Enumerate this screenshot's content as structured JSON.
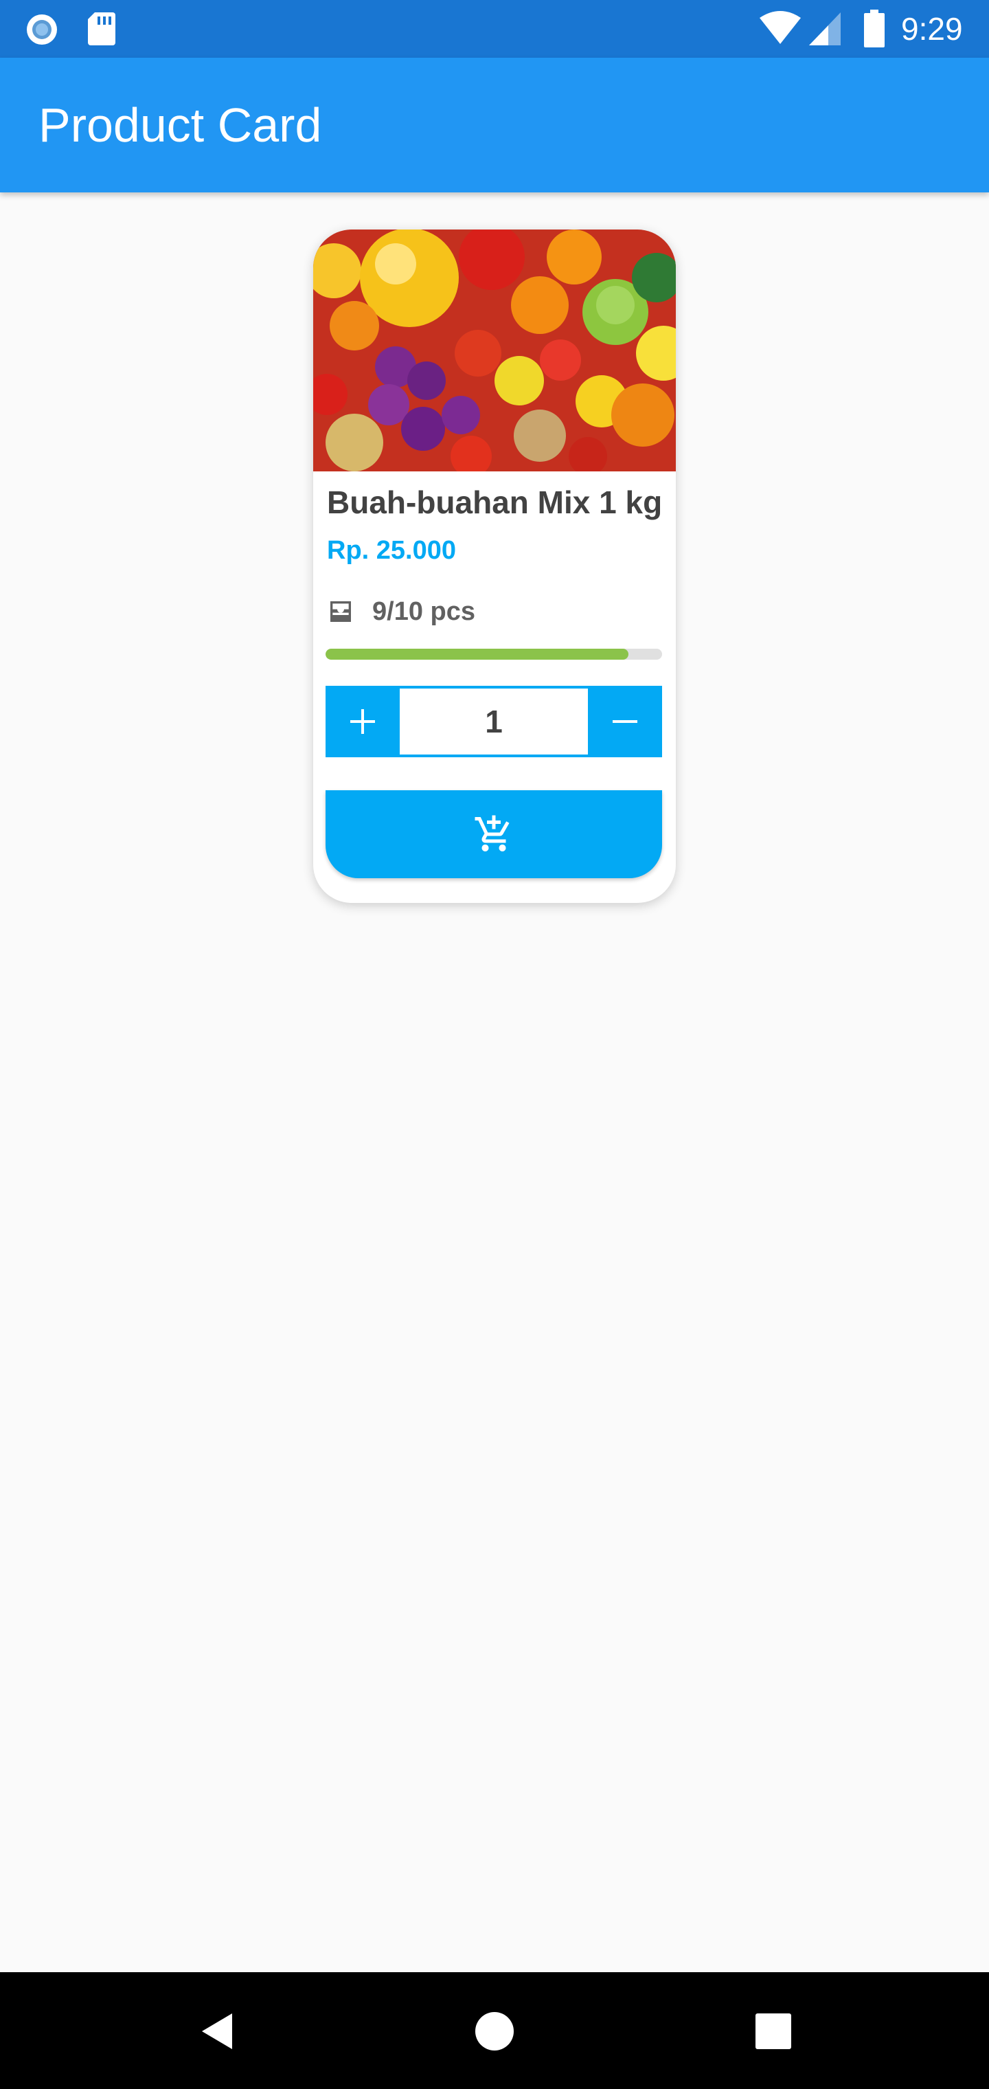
{
  "status_bar": {
    "time": "9:29",
    "icons": [
      "circle-notification-icon",
      "sd-card-icon",
      "wifi-icon",
      "signal-icon",
      "battery-icon"
    ]
  },
  "app_bar": {
    "title": "Product Card",
    "color": "#2196f3"
  },
  "product": {
    "name": "Buah-buahan Mix 1 kg",
    "price": "Rp. 25.000",
    "stock_label": "9/10 pcs",
    "stock_progress": 0.9,
    "quantity": "1",
    "image": "mixed-fruits-photo",
    "accent_color": "#03a9f4",
    "progress_color": "#8bc34a"
  },
  "stepper": {
    "increment_icon": "plus-icon",
    "decrement_icon": "minus-icon"
  },
  "cart_button": {
    "icon": "add-shopping-cart-icon"
  },
  "nav_bar": {
    "icons": [
      "back-icon",
      "home-icon",
      "recents-icon"
    ]
  }
}
